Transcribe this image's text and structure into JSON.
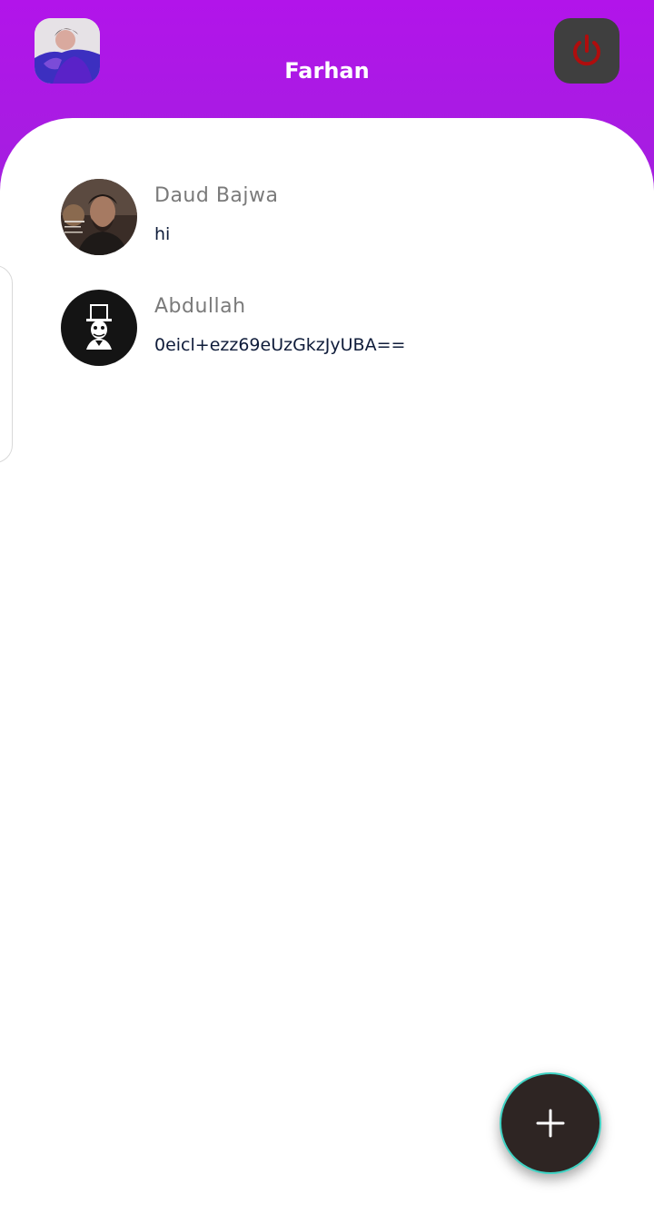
{
  "header": {
    "title": "Farhan",
    "profile_icon": "user-avatar",
    "logout_icon": "power-icon",
    "gradient_colors": [
      "#b214ea",
      "#a41fdf"
    ],
    "logout_icon_color": "#b00d0d"
  },
  "chats": [
    {
      "name": "Daud Bajwa",
      "last_message": "hi",
      "avatar": "photo-avatar"
    },
    {
      "name": "Abdullah",
      "last_message": "0eicl+ezz69eUzGkzJyUBA==",
      "avatar": "top-hat-avatar"
    }
  ],
  "fab": {
    "icon": "plus-icon",
    "color": "#2e2523",
    "ring_color": "#3fd3c4"
  }
}
